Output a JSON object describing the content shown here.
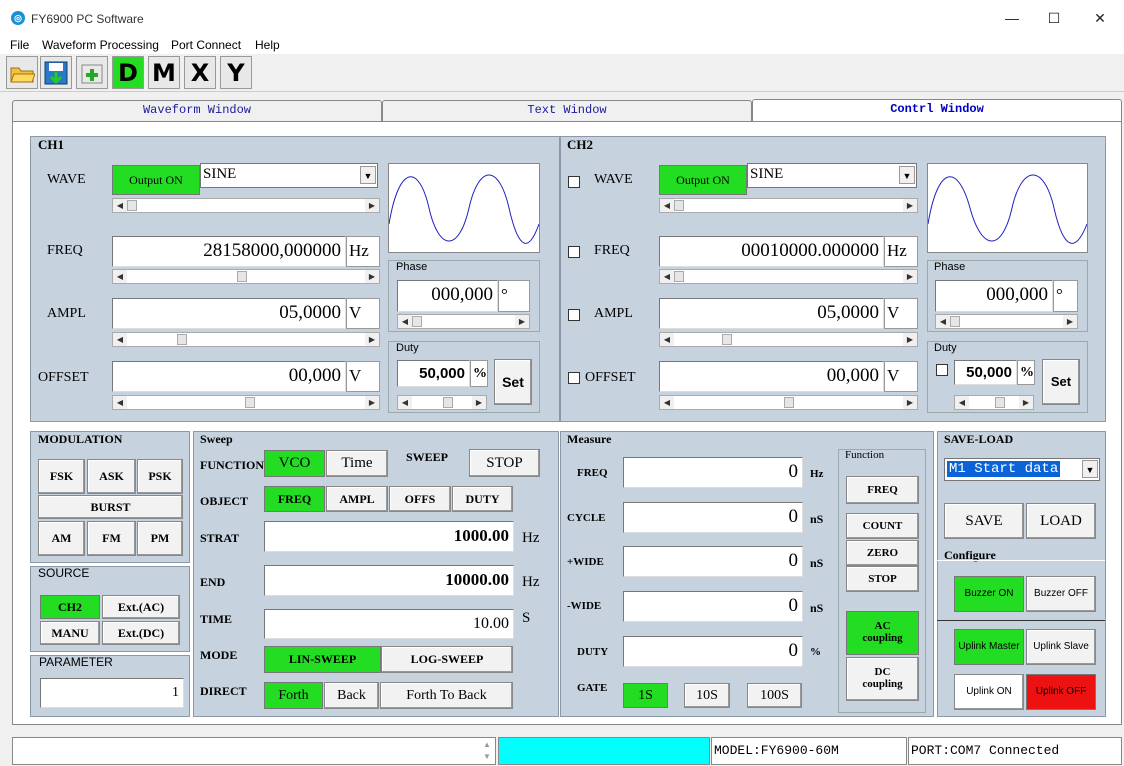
{
  "app": {
    "icon": "app-logo-icon",
    "title": "FY6900 PC Software"
  },
  "window": {
    "minimize": "—",
    "maximize": "☐",
    "close": "✕"
  },
  "menu": [
    "File",
    "Waveform Processing",
    "Port Connect",
    "Help"
  ],
  "toolbar": {
    "open": "open-folder-icon",
    "save": "save-disk-icon",
    "add": "add-icon",
    "d": "D",
    "m": "M",
    "x": "X",
    "y": "Y"
  },
  "tabs": [
    "Waveform Window",
    "Text Window",
    "Contrl Window"
  ],
  "ch1": {
    "title": "CH1",
    "wave_label": "WAVE",
    "output_btn": "Output ON",
    "wave_value": "SINE",
    "freq_label": "FREQ",
    "freq_value": "28158000,000000",
    "freq_unit": "Hz",
    "ampl_label": "AMPL",
    "ampl_value": "05,0000",
    "ampl_unit": "V",
    "offset_label": "OFFSET",
    "offset_value": "00,000",
    "offset_unit": "V",
    "phase_label": "Phase",
    "phase_value": "000,000",
    "phase_unit": "°",
    "duty_label": "Duty",
    "duty_value": "50,000",
    "duty_unit": "%",
    "set_btn": "Set"
  },
  "ch2": {
    "title": "CH2",
    "wave_label": "WAVE",
    "output_btn": "Output ON",
    "wave_value": "SINE",
    "freq_label": "FREQ",
    "freq_value": "00010000.000000",
    "freq_unit": "Hz",
    "ampl_label": "AMPL",
    "ampl_value": "05,0000",
    "ampl_unit": "V",
    "offset_label": "OFFSET",
    "offset_value": "00,000",
    "offset_unit": "V",
    "phase_label": "Phase",
    "phase_value": "000,000",
    "phase_unit": "°",
    "duty_label": "Duty",
    "duty_value": "50,000",
    "duty_unit": "%",
    "set_btn": "Set"
  },
  "modulation": {
    "title": "MODULATION",
    "fsk": "FSK",
    "ask": "ASK",
    "psk": "PSK",
    "burst": "BURST",
    "am": "AM",
    "fm": "FM",
    "pm": "PM"
  },
  "source": {
    "title": "SOURCE",
    "ch2": "CH2",
    "ext_ac": "Ext.(AC)",
    "manu": "MANU",
    "ext_dc": "Ext.(DC)"
  },
  "parameter": {
    "title": "PARAMETER",
    "value": "1"
  },
  "sweep": {
    "title": "Sweep",
    "function_label": "FUNCTION",
    "vco": "VCO",
    "time": "Time",
    "sweep_label": "SWEEP",
    "stop": "STOP",
    "object_label": "OBJECT",
    "freq": "FREQ",
    "ampl": "AMPL",
    "offs": "OFFS",
    "duty": "DUTY",
    "strat_label": "STRAT",
    "strat_value": "1000.00",
    "strat_unit": "Hz",
    "end_label": "END",
    "end_value": "10000.00",
    "end_unit": "Hz",
    "time_label": "TIME",
    "time_value": "10.00",
    "time_unit": "S",
    "mode_label": "MODE",
    "lin": "LIN-SWEEP",
    "log": "LOG-SWEEP",
    "direct_label": "DIRECT",
    "forth": "Forth",
    "back": "Back",
    "forth_back": "Forth To Back"
  },
  "measure": {
    "title": "Measure",
    "freq_label": "FREQ",
    "freq_value": "0",
    "freq_unit": "Hz",
    "cycle_label": "CYCLE",
    "cycle_value": "0",
    "cycle_unit": "nS",
    "pwide_label": "+WIDE",
    "pwide_value": "0",
    "pwide_unit": "nS",
    "nwide_label": "-WIDE",
    "nwide_value": "0",
    "nwide_unit": "nS",
    "duty_label": "DUTY",
    "duty_value": "0",
    "duty_unit": "%",
    "gate_label": "GATE",
    "g1": "1S",
    "g10": "10S",
    "g100": "100S"
  },
  "function": {
    "title": "Function",
    "freq": "FREQ",
    "count": "COUNT",
    "zero": "ZERO",
    "stop": "STOP",
    "ac1": "AC",
    "ac2": "coupling",
    "dc1": "DC",
    "dc2": "coupling"
  },
  "saveload": {
    "title": "SAVE-LOAD",
    "slot": "M1 Start data",
    "save": "SAVE",
    "load": "LOAD"
  },
  "configure": {
    "title": "Configure",
    "buzzer_on": "Buzzer ON",
    "buzzer_off": "Buzzer OFF",
    "uplink_master": "Uplink Master",
    "uplink_slave": "Uplink Slave",
    "uplink_on": "Uplink ON",
    "uplink_off": "Uplink OFF"
  },
  "statusbar": {
    "model": "MODEL:FY6900-60M",
    "port": "PORT:COM7 Connected",
    "progress_color": "#00ffff"
  },
  "colors": {
    "on_green": "#22dd22",
    "off_red": "#ee1111",
    "panel": "#c6d3df"
  }
}
